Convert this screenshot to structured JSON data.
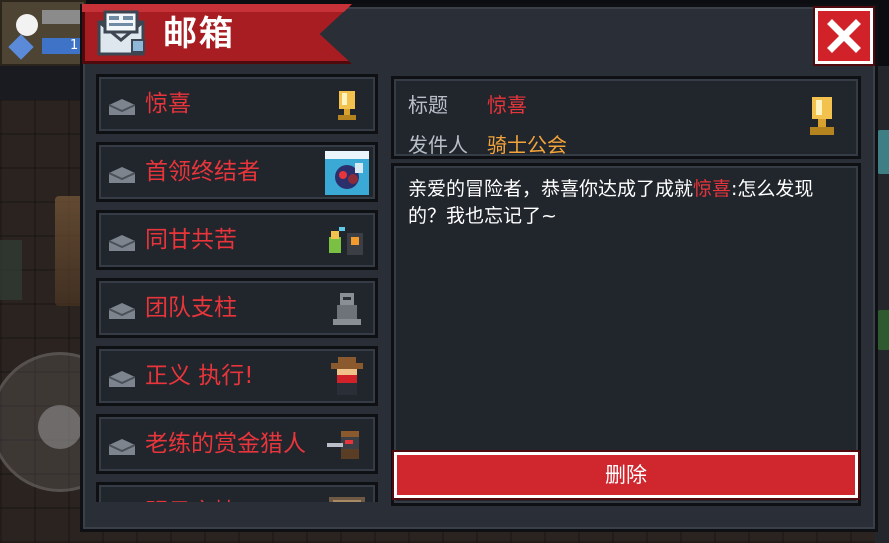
{
  "hud": {
    "mana_value": "1"
  },
  "dialog": {
    "title": "邮箱",
    "close_icon": "close-x-icon",
    "accent": "#d12229"
  },
  "mail_list": [
    {
      "label": "惊喜",
      "icon": "trophy-icon"
    },
    {
      "label": "首领终结者",
      "icon": "boss-portrait-icon"
    },
    {
      "label": "同甘共苦",
      "icon": "duo-characters-icon"
    },
    {
      "label": "团队支柱",
      "icon": "knight-statue-icon"
    },
    {
      "label": "正义 执行!",
      "icon": "cowboy-icon"
    },
    {
      "label": "老练的赏金猎人",
      "icon": "bounty-hunter-icon"
    },
    {
      "label": "明日之捷",
      "icon": "scroll-icon"
    }
  ],
  "detail": {
    "title_label": "标题",
    "title_value": "惊喜",
    "sender_label": "发件人",
    "sender_value": "骑士公会",
    "body_before": "亲爱的冒险者，恭喜你达成了成就",
    "body_highlight": "惊喜",
    "body_after": ":怎么发现的？我也忘记了~",
    "delete_label": "删除"
  }
}
